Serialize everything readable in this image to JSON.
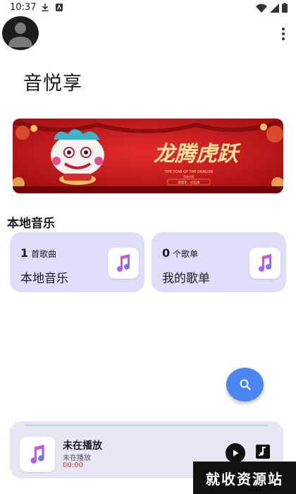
{
  "status_bar": {
    "time": "10:37",
    "left_icons": [
      "download-icon",
      "notification-app-icon"
    ],
    "right_icons": [
      "wifi-icon",
      "signal-icon",
      "battery-icon"
    ]
  },
  "header": {
    "avatar_icon": "user-avatar-icon",
    "menu_icon": "more-vert-icon"
  },
  "app": {
    "title": "音悦享"
  },
  "banner": {
    "main_text": "龙腾虎跃",
    "caption_en": "THE YEAR OF THE DRAGON",
    "caption_small": "百业兴旺",
    "caption_line": "迎新年 · 好运来",
    "colors": {
      "background": "#c8141c",
      "gold": "#f3c35b"
    }
  },
  "local_music": {
    "section_title": "本地音乐",
    "cards": [
      {
        "count": "1",
        "unit": "首歌曲",
        "label": "本地音乐",
        "icon": "music-note-icon"
      },
      {
        "count": "0",
        "unit": "个歌单",
        "label": "我的歌单",
        "icon": "music-note-icon"
      }
    ]
  },
  "search_fab": {
    "icon": "search-icon",
    "color": "#4c85f4"
  },
  "player": {
    "title": "未在播放",
    "subtitle": "未在播放",
    "time": "00:00",
    "progress": 0,
    "play_icon": "play-icon",
    "playlist_icon": "queue-music-icon"
  },
  "watermark": {
    "text": "就收资源站"
  },
  "colors": {
    "card_bg": "#dfdefa",
    "player_bg": "#e6e6f5",
    "accent_red": "#e53935"
  }
}
